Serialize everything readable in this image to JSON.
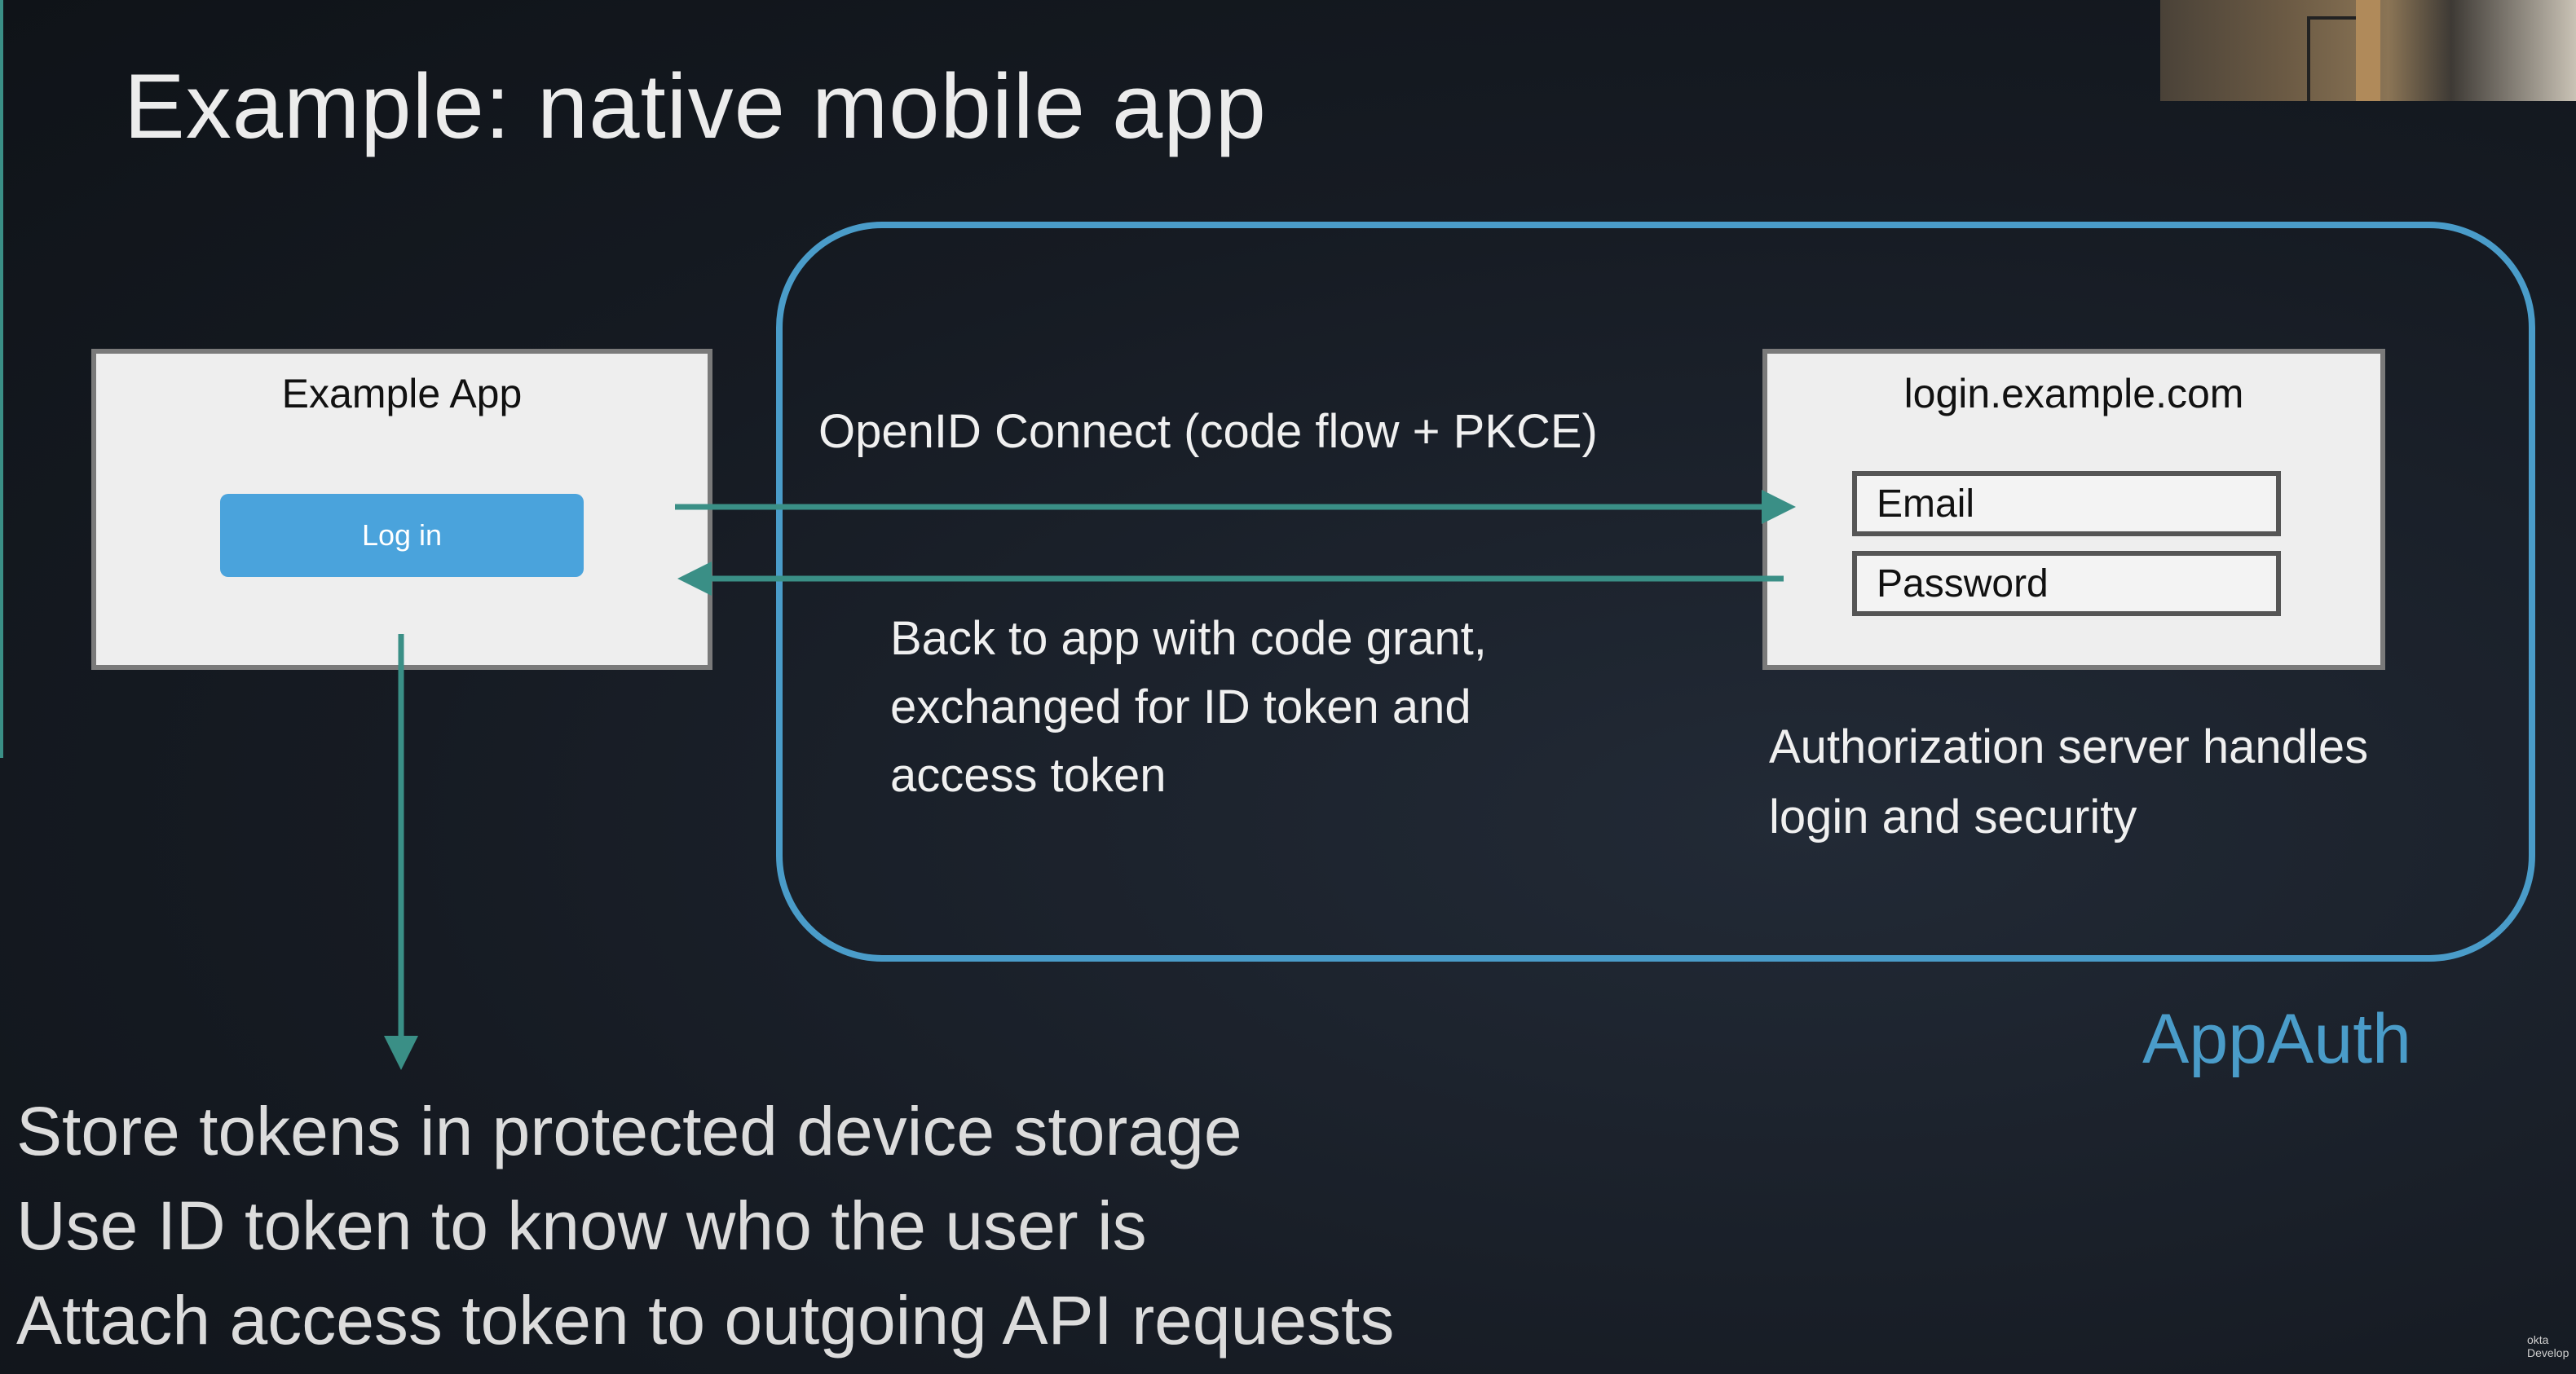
{
  "slide": {
    "title": "Example: native mobile app"
  },
  "colors": {
    "background": "#161b23",
    "arrow": "#3a8f86",
    "appauth_border": "#4a9cc9",
    "button": "#4aa3dc",
    "panel": "#eeeeee"
  },
  "app_panel": {
    "title": "Example App",
    "login_button": "Log in"
  },
  "server_panel": {
    "title": "login.example.com",
    "email_field": "Email",
    "password_field": "Password"
  },
  "flow": {
    "forward_label": "OpenID Connect (code flow + PKCE)",
    "back_label_lines": [
      "Back to app with code grant,",
      "exchanged for ID token and",
      "access token"
    ]
  },
  "server_note_lines": [
    "Authorization server handles",
    "login and security"
  ],
  "appauth_label": "AppAuth",
  "bottom_list": [
    "Store tokens in protected device storage",
    "Use ID token to know who the user is",
    "Attach access token to outgoing API requests"
  ],
  "watermark_lines": [
    "okta",
    "Develop"
  ]
}
